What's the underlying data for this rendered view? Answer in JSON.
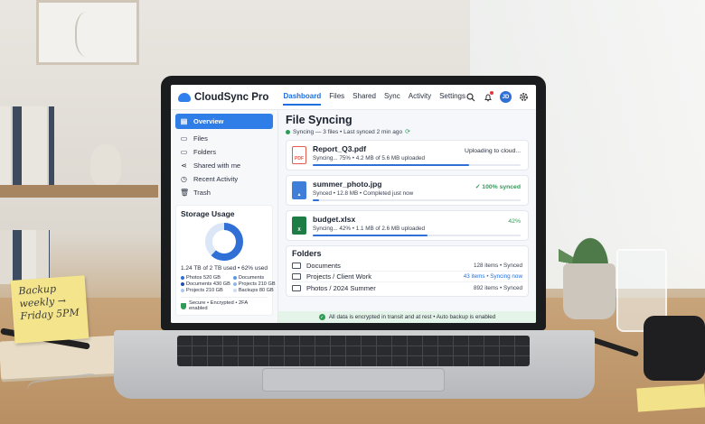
{
  "app": {
    "name": "CloudSync Pro",
    "brand_color": "#2f80ed"
  },
  "nav": {
    "items": [
      {
        "label": "Dashboard",
        "active": true
      },
      {
        "label": "Files"
      },
      {
        "label": "Shared"
      },
      {
        "label": "Sync"
      },
      {
        "label": "Activity"
      },
      {
        "label": "Settings"
      }
    ],
    "icons": [
      "search-icon",
      "bell-icon",
      "gear-icon"
    ],
    "avatar_initials": "JD"
  },
  "sidebar": {
    "items": [
      {
        "label": "Overview",
        "icon": "overview-icon",
        "active": true
      },
      {
        "label": "Files",
        "icon": "file-icon"
      },
      {
        "label": "Folders",
        "icon": "folder-icon"
      },
      {
        "label": "Shared with me",
        "icon": "share-icon"
      },
      {
        "label": "Recent Activity",
        "icon": "clock-icon"
      },
      {
        "label": "Trash",
        "icon": "trash-icon"
      }
    ]
  },
  "storage": {
    "title": "Storage Usage",
    "used_fraction": 0.62,
    "summary": "1.24 TB of 2 TB used • 62% used",
    "legend": [
      {
        "label": "Photos 520 GB",
        "color": "#2f6fd6"
      },
      {
        "label": "Documents",
        "color": "#5a9be8"
      },
      {
        "label": "Documents 430 GB",
        "color": "#1f4fa8"
      },
      {
        "label": "Projects 210 GB",
        "color": "#8fb8ef"
      },
      {
        "label": "Projects 210 GB",
        "color": "#a9c8f2"
      },
      {
        "label": "Backups 80 GB",
        "color": "#c9dcf6"
      }
    ],
    "secure_text": "Secure • Encrypted • 2FA enabled"
  },
  "main": {
    "title": "File Syncing",
    "status": "Syncing — 3 files • Last synced 2 min ago",
    "files": [
      {
        "name": "Report_Q3.pdf",
        "type": "PDF",
        "meta": "Syncing... 75% • 4.2 MB of 5.6 MB uploaded",
        "state": "Uploading to cloud...",
        "state_kind": "uploading",
        "progress": 0.75
      },
      {
        "name": "summer_photo.jpg",
        "type": "IMG",
        "meta": "Synced • 12.8 MB • Completed just now",
        "state": "100% synced",
        "state_kind": "ok",
        "progress": 0.03
      },
      {
        "name": "budget.xlsx",
        "type": "X",
        "meta": "Syncing... 42% • 1.1 MB of 2.6 MB uploaded",
        "state": "42%",
        "state_kind": "pct",
        "progress": 0.55
      }
    ],
    "folders_title": "Folders",
    "folders": [
      {
        "name": "Documents",
        "status": "128 items • Synced",
        "active": false
      },
      {
        "name": "Projects / Client Work",
        "status": "43 items • Syncing now",
        "active": true
      },
      {
        "name": "Photos / 2024 Summer",
        "status": "892 items • Synced",
        "active": false
      }
    ],
    "footer": "All data is encrypted in transit and at rest • Auto backup is enabled"
  },
  "sticky_note": {
    "lines": [
      "Backup",
      "weekly →",
      "Friday 5PM"
    ]
  }
}
